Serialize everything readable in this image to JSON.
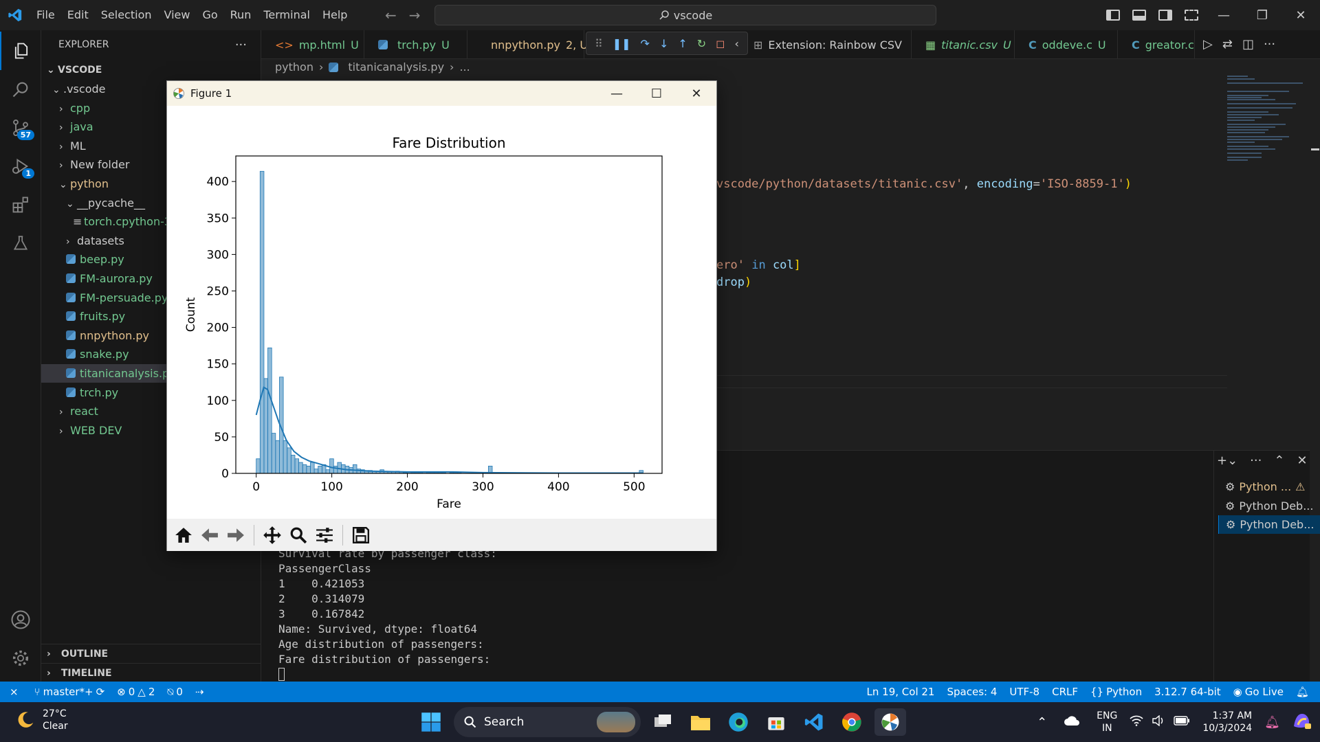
{
  "titlebar": {
    "menu": [
      "File",
      "Edit",
      "Selection",
      "View",
      "Go",
      "Run",
      "Terminal",
      "Help"
    ],
    "search_text": "vscode"
  },
  "activity": {
    "scm_badge": "57",
    "debug_badge": "1"
  },
  "sidebar": {
    "header": "EXPLORER",
    "root": "VSCODE",
    "items": [
      {
        "label": ".vscode",
        "kind": "folder-open"
      },
      {
        "label": "cpp",
        "kind": "folder"
      },
      {
        "label": "java",
        "kind": "folder"
      },
      {
        "label": "ML",
        "kind": "folder"
      },
      {
        "label": "New folder",
        "kind": "folder"
      },
      {
        "label": "python",
        "kind": "folder-open"
      },
      {
        "label": "__pycache__",
        "kind": "folder-open"
      },
      {
        "label": "torch.cpython-31",
        "kind": "file"
      },
      {
        "label": "datasets",
        "kind": "folder"
      },
      {
        "label": "beep.py",
        "kind": "py"
      },
      {
        "label": "FM-aurora.py",
        "kind": "py"
      },
      {
        "label": "FM-persuade.py",
        "kind": "py"
      },
      {
        "label": "fruits.py",
        "kind": "py"
      },
      {
        "label": "nnpython.py",
        "kind": "py"
      },
      {
        "label": "snake.py",
        "kind": "py"
      },
      {
        "label": "titanicanalysis.py",
        "kind": "py"
      },
      {
        "label": "trch.py",
        "kind": "py"
      },
      {
        "label": "react",
        "kind": "folder"
      },
      {
        "label": "WEB DEV",
        "kind": "folder"
      }
    ],
    "outline": "OUTLINE",
    "timeline": "TIMELINE"
  },
  "tabs": [
    {
      "label": "mp.html",
      "status": "U"
    },
    {
      "label": "trch.py",
      "status": "U"
    },
    {
      "label": "nnpython.py",
      "status": "2, U"
    },
    {
      "label": "Extension: Rainbow CSV",
      "status": ""
    },
    {
      "label": "titanic.csv",
      "status": "U"
    },
    {
      "label": "oddeve.c",
      "status": "U"
    },
    {
      "label": "greator.c",
      "status": ""
    }
  ],
  "breadcrumb": [
    "python",
    "titanicanalysis.py",
    "..."
  ],
  "code": {
    "line1_str": "vscode/python/datasets/titanic.csv'",
    "line1_kw": "encoding",
    "line1_val": "'ISO-8859-1'",
    "line2_str": "ero'",
    "line2_kw": "in",
    "line2_id": "col",
    "line3_id": "drop"
  },
  "terminal": {
    "lines": [
      "Survival rate by passenger class:",
      "PassengerClass",
      "1    0.421053",
      "2    0.314079",
      "3    0.167842",
      "Name: Survived, dtype: float64",
      "Age distribution of passengers:",
      "Fare distribution of passengers:"
    ],
    "sessions": [
      "Python ...",
      "Python Deb...",
      "Python Deb..."
    ]
  },
  "statusbar": {
    "branch": "master*+",
    "errors": "0",
    "warnings": "2",
    "ports": "0",
    "position": "Ln 19, Col 21",
    "spaces": "Spaces: 4",
    "encoding": "UTF-8",
    "eol": "CRLF",
    "language": "Python",
    "interpreter": "3.12.7 64-bit",
    "golive": "Go Live"
  },
  "taskbar": {
    "temp": "27°C",
    "condition": "Clear",
    "search": "Search",
    "lang1": "ENG",
    "lang2": "IN",
    "time": "1:37 AM",
    "date": "10/3/2024"
  },
  "figure": {
    "window_title": "Figure 1"
  },
  "chart_data": {
    "type": "bar",
    "title": "Fare Distribution",
    "xlabel": "Fare",
    "ylabel": "Count",
    "xlim": [
      -27,
      537
    ],
    "ylim": [
      0,
      435
    ],
    "xticks": [
      0,
      100,
      200,
      300,
      400,
      500
    ],
    "yticks": [
      0,
      50,
      100,
      150,
      200,
      250,
      300,
      350,
      400
    ],
    "bin_width": 5.12,
    "bins_start": 0,
    "counts": [
      20,
      414,
      130,
      172,
      55,
      45,
      132,
      45,
      35,
      25,
      20,
      15,
      12,
      10,
      15,
      6,
      10,
      12,
      5,
      20,
      10,
      15,
      12,
      10,
      8,
      12,
      6,
      5,
      4,
      4,
      3,
      3,
      5,
      3,
      2,
      2,
      3,
      2,
      1,
      2,
      1,
      1,
      1,
      2,
      1,
      1,
      1,
      1,
      1,
      0,
      1,
      1,
      1,
      0,
      0,
      0,
      1,
      1,
      0,
      0,
      10,
      1,
      1,
      0,
      1,
      1,
      0,
      1,
      0,
      0,
      0,
      0,
      0,
      0,
      0,
      0,
      0,
      0,
      0,
      0,
      0,
      0,
      0,
      0,
      0,
      0,
      0,
      0,
      0,
      0,
      0,
      0,
      0,
      0,
      0,
      0,
      0,
      0,
      0,
      4
    ],
    "kde": [
      [
        0,
        80
      ],
      [
        5,
        100
      ],
      [
        10,
        118
      ],
      [
        15,
        115
      ],
      [
        20,
        100
      ],
      [
        30,
        70
      ],
      [
        40,
        45
      ],
      [
        50,
        30
      ],
      [
        60,
        22
      ],
      [
        70,
        17
      ],
      [
        80,
        14
      ],
      [
        90,
        11
      ],
      [
        100,
        8
      ],
      [
        120,
        5
      ],
      [
        150,
        3
      ],
      [
        200,
        2
      ],
      [
        260,
        2
      ],
      [
        300,
        1
      ],
      [
        400,
        0.5
      ],
      [
        512,
        0.5
      ]
    ],
    "bar_color": "#1f77b4"
  }
}
